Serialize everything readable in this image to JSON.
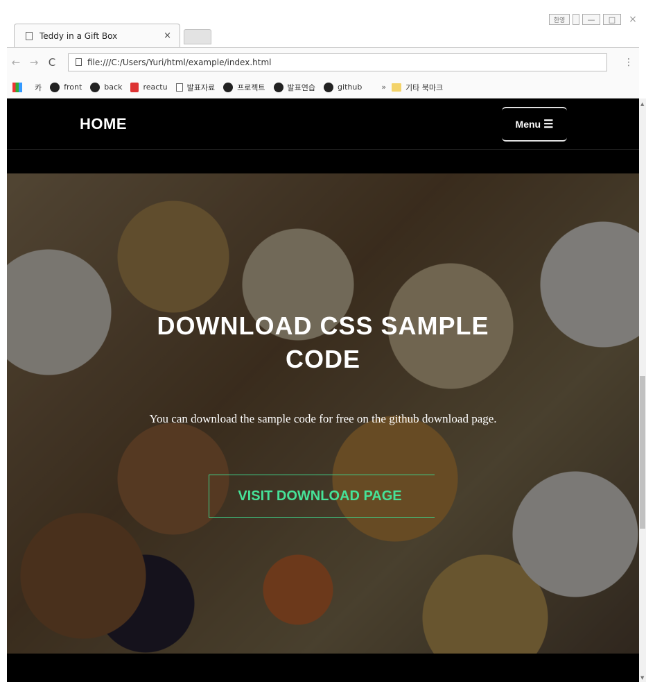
{
  "browser": {
    "tab": {
      "title": "Teddy in a Gift Box",
      "close": "×"
    },
    "window_controls": {
      "lang": "한영",
      "min": "—",
      "max": "□",
      "close": "×"
    },
    "nav": {
      "back": "←",
      "forward": "→",
      "reload": "C",
      "url": "file:///C:/Users/Yuri/html/example/index.html",
      "menu": "⋮"
    },
    "bookmarks": [
      {
        "label": "",
        "icon": "apps-icon"
      },
      {
        "label": "카",
        "icon": "blank"
      },
      {
        "label": "front",
        "icon": "github-icon"
      },
      {
        "label": "back",
        "icon": "github-icon"
      },
      {
        "label": "reactu",
        "icon": "react-icon"
      },
      {
        "label": "발표자료",
        "icon": "doc-icon"
      },
      {
        "label": "프로젝트",
        "icon": "github-icon"
      },
      {
        "label": "발표연습",
        "icon": "github-icon"
      },
      {
        "label": "github",
        "icon": "github-icon"
      }
    ],
    "bookmarks_overflow": "»",
    "other_bookmarks": "기타 북마크"
  },
  "site": {
    "brand": "HOME",
    "menu_label": "Menu",
    "menu_icon": "☰",
    "hero": {
      "title_line1": "DOWNLOAD CSS SAMPLE",
      "title_line2": "CODE",
      "text": "You can download the sample code for free on the github download page.",
      "cta": "VISIT DOWNLOAD PAGE"
    }
  },
  "colors": {
    "accent": "#46e298",
    "nav_bg": "#000000"
  }
}
